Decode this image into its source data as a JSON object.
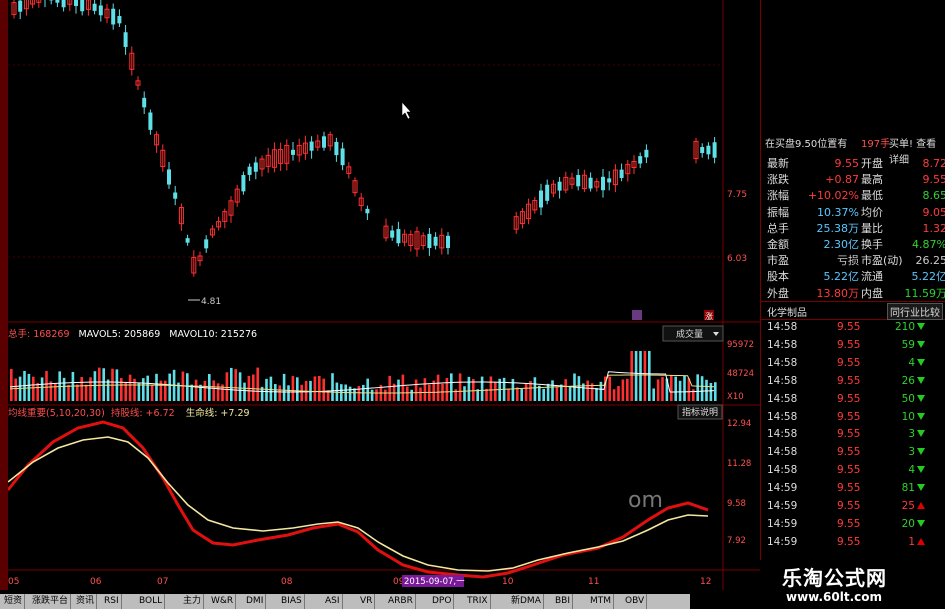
{
  "main_chart": {
    "price_labels": [
      "7.75",
      "6.03"
    ],
    "low_marker": "4.81",
    "red_badge": "涨"
  },
  "volume_panel": {
    "legend": [
      {
        "text": "总手: 168269",
        "color": "#ff4d4d"
      },
      {
        "text": "MAVOL5: 205869",
        "color": "#ffffff"
      },
      {
        "text": "MAVOL10: 215276",
        "color": "#ffffff"
      }
    ],
    "dropdown_label": "成交量",
    "y_labels": [
      "95972",
      "48724",
      "X10"
    ]
  },
  "indicator_panel": {
    "name": "均线重要(5,10,20,30)",
    "line1": "持股线: +6.72",
    "line2": "生命线: +7.29",
    "button": "指标说明",
    "y_labels": [
      "12.94",
      "11.28",
      "9.58",
      "7.92"
    ],
    "colors": {
      "hold": "#e01010",
      "life": "#f2e8a0"
    }
  },
  "x_axis": {
    "labels": [
      "05",
      "06",
      "07",
      "08",
      "09",
      "10",
      "11",
      "12"
    ],
    "highlight_date": "2015-09-07,一"
  },
  "right_panel": {
    "header_left": "在买盘9.50位置有",
    "header_mid": "197手",
    "header_right": "买单!  查看详细",
    "quotes": [
      {
        "l1": "最新",
        "v1": "9.55",
        "l2": "开盘",
        "v2": "8.72",
        "c1": "#ff3b3b",
        "c2": "#ff3b3b"
      },
      {
        "l1": "涨跌",
        "v1": "+0.87",
        "l2": "最高",
        "v2": "9.55",
        "c1": "#ff3b3b",
        "c2": "#ff3b3b"
      },
      {
        "l1": "涨幅",
        "v1": "+10.02%",
        "l2": "最低",
        "v2": "8.65",
        "c1": "#ff3b3b",
        "c2": "#2fd12f"
      },
      {
        "l1": "振幅",
        "v1": "10.37%",
        "l2": "均价",
        "v2": "9.05",
        "c1": "#58c8ff",
        "c2": "#ff3b3b"
      },
      {
        "l1": "总手",
        "v1": "25.38万",
        "l2": "量比",
        "v2": "1.32",
        "c1": "#58c8ff",
        "c2": "#ff3b3b"
      },
      {
        "l1": "金额",
        "v1": "2.30亿",
        "l2": "换手",
        "v2": "4.87%",
        "c1": "#58c8ff",
        "c2": "#2fd12f"
      },
      {
        "l1": "市盈",
        "v1": "亏损",
        "l2": "市盈(动)",
        "v2": "26.25",
        "c1": "#cccccc",
        "c2": "#cccccc"
      },
      {
        "l1": "股本",
        "v1": "5.22亿",
        "l2": "流通",
        "v2": "5.22亿",
        "c1": "#58c8ff",
        "c2": "#58c8ff"
      },
      {
        "l1": "外盘",
        "v1": "13.80万",
        "l2": "内盘",
        "v2": "11.59万",
        "c1": "#ff3b3b",
        "c2": "#2fd12f"
      }
    ],
    "industry_left": "化学制品",
    "industry_right": "同行业比较",
    "trades": [
      {
        "t": "14:58",
        "p": "9.55",
        "q": "210",
        "d": "down"
      },
      {
        "t": "14:58",
        "p": "9.55",
        "q": "59",
        "d": "down"
      },
      {
        "t": "14:58",
        "p": "9.55",
        "q": "4",
        "d": "down"
      },
      {
        "t": "14:58",
        "p": "9.55",
        "q": "26",
        "d": "down"
      },
      {
        "t": "14:58",
        "p": "9.55",
        "q": "50",
        "d": "down"
      },
      {
        "t": "14:58",
        "p": "9.55",
        "q": "10",
        "d": "down"
      },
      {
        "t": "14:58",
        "p": "9.55",
        "q": "3",
        "d": "down"
      },
      {
        "t": "14:58",
        "p": "9.55",
        "q": "3",
        "d": "down"
      },
      {
        "t": "14:58",
        "p": "9.55",
        "q": "4",
        "d": "down"
      },
      {
        "t": "14:59",
        "p": "9.55",
        "q": "81",
        "d": "down"
      },
      {
        "t": "14:59",
        "p": "9.55",
        "q": "25",
        "d": "up"
      },
      {
        "t": "14:59",
        "p": "9.55",
        "q": "20",
        "d": "down"
      },
      {
        "t": "14:59",
        "p": "9.55",
        "q": "1",
        "d": "up"
      }
    ]
  },
  "watermark": "om",
  "brand": {
    "title": "乐淘公式网",
    "url": "www.60lt.com"
  },
  "tabs": [
    "短资",
    "涨跌平台",
    "资讯",
    "RSI",
    "BOLL",
    "主力",
    "W&R",
    "DMI",
    "BIAS",
    "ASI",
    "VR",
    "ARBR",
    "DPO",
    "TRIX",
    "新DMA",
    "BBI",
    "MTM",
    "OBV",
    "SAR",
    "EXPMA",
    "资金",
    "成交",
    "均线重要"
  ]
}
